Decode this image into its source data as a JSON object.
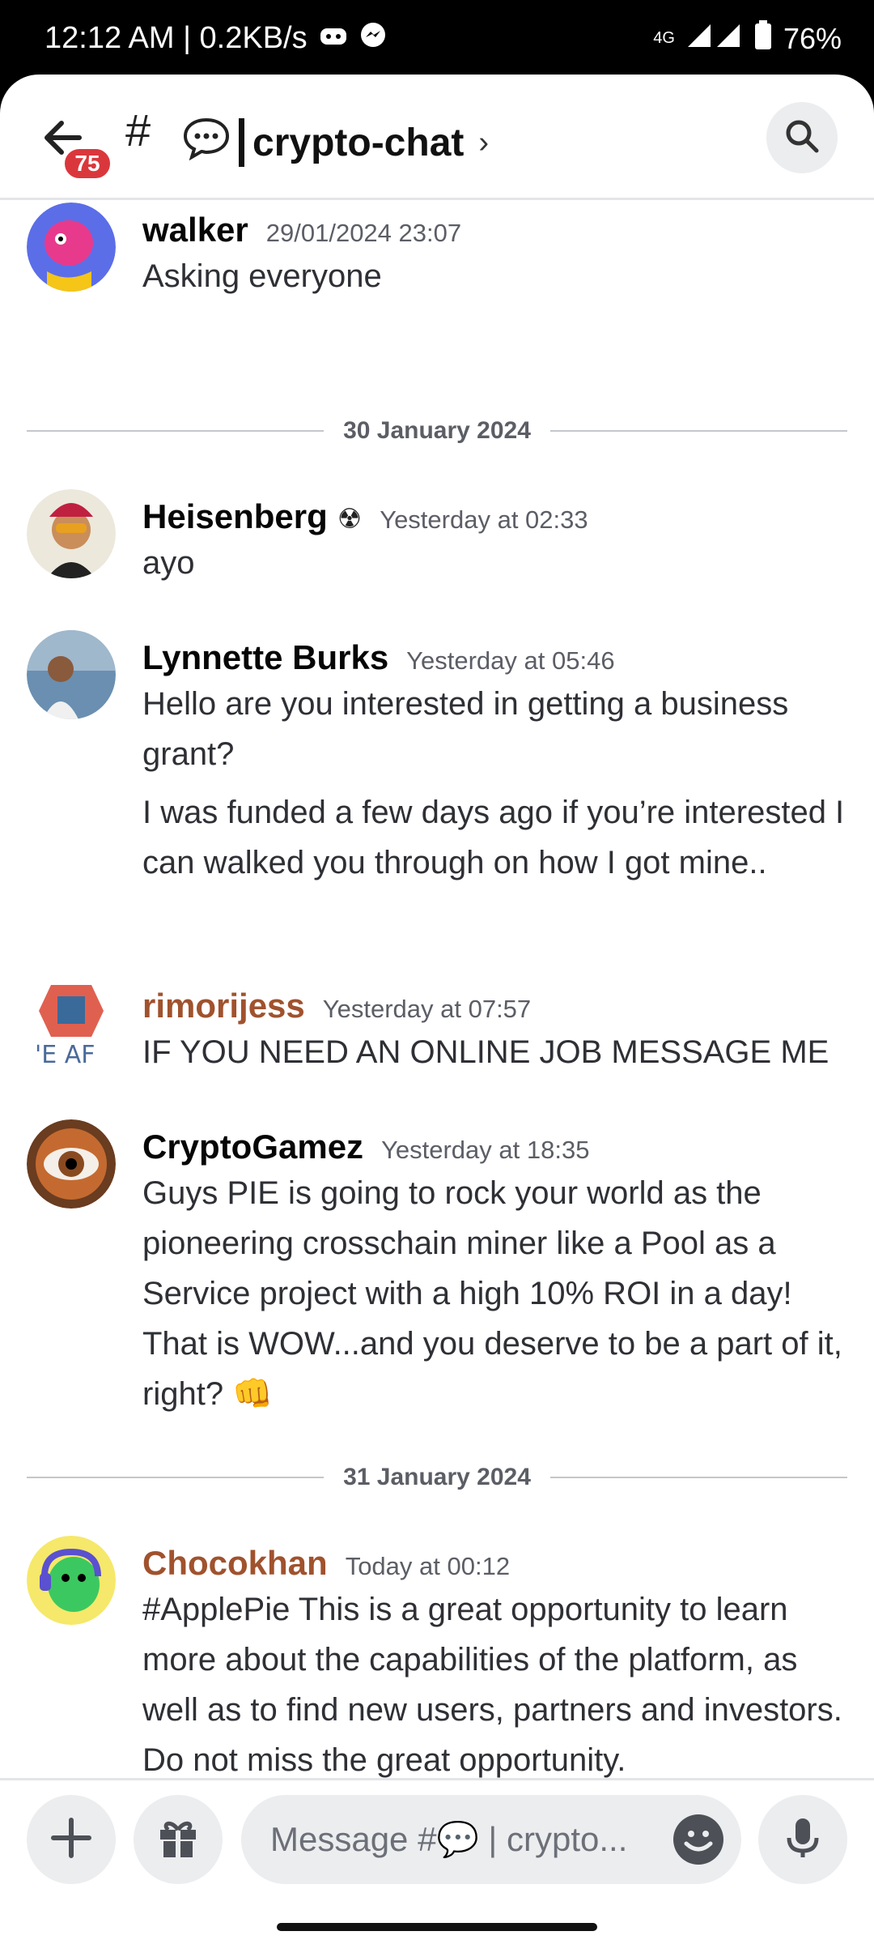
{
  "status_bar": {
    "time_speed": "12:12 AM | 0.2KB/s",
    "network": "4G",
    "battery": "76%"
  },
  "header": {
    "unread_count": "75",
    "hash": "#",
    "channel_name": "crypto-chat",
    "chevron": "›"
  },
  "messages": [
    {
      "author": "walker",
      "time": "29/01/2024 23:07",
      "lines": [
        "Asking everyone"
      ]
    },
    {
      "author": "Heisenberg",
      "badge": "☢",
      "time": "Yesterday at 02:33",
      "lines": [
        "ayo"
      ]
    },
    {
      "author": "Lynnette Burks",
      "time": "Yesterday at 05:46",
      "lines": [
        "Hello are you interested in getting a business grant?",
        "I was funded a few days ago if you’re interested I can walked you through on how I got mine.."
      ]
    },
    {
      "author": "rimorijess",
      "time": "Yesterday at 07:57",
      "lines": [
        "IF YOU NEED AN ONLINE JOB MESSAGE ME"
      ]
    },
    {
      "author": "CryptoGamez",
      "time": "Yesterday at 18:35",
      "lines": [
        "Guys PIE is going to rock your world as the pioneering crosschain miner like a Pool as a Service project with a high 10% ROI in a day! That is WOW...and you deserve to be a part of it, right? 👊"
      ]
    },
    {
      "author": "Chocokhan",
      "time": "Today at 00:12",
      "lines": [
        "#ApplePie This is a great opportunity to learn more about the capabilities of the platform, as well as to find new users, partners and investors. Do not miss the great opportunity."
      ]
    }
  ],
  "dividers": [
    "30 January 2024",
    "31 January 2024"
  ],
  "composer": {
    "placeholder": "Message #💬 | crypto..."
  },
  "colors": {
    "accent_badge": "#da373c",
    "orange_name": "#a0522d"
  }
}
